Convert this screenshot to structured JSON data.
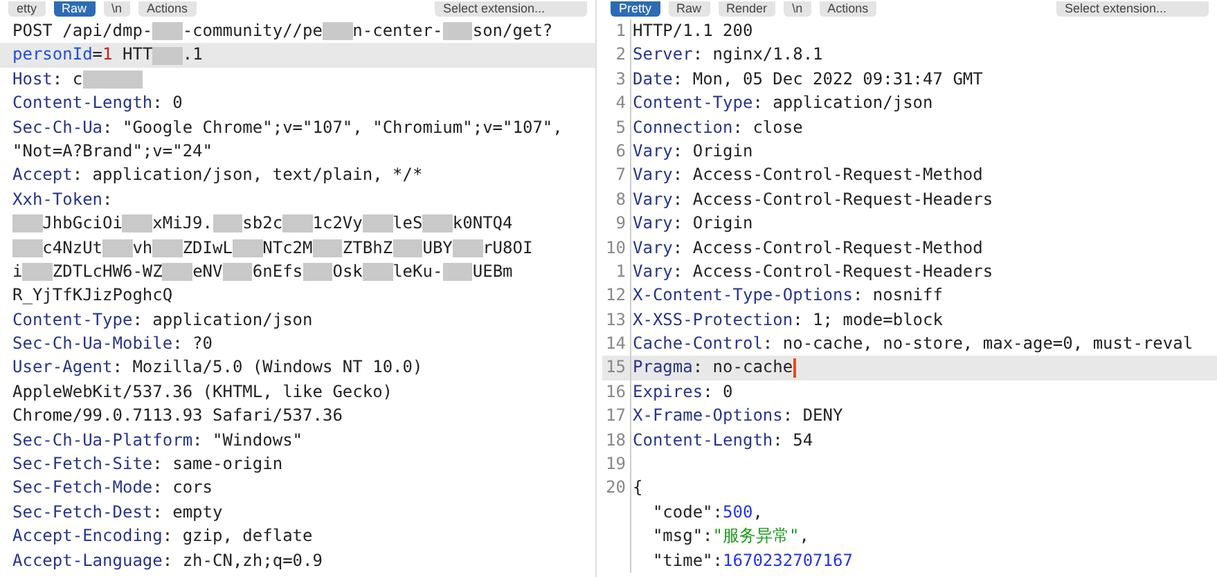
{
  "request": {
    "toolbar": {
      "tabs": [
        {
          "label": "etty",
          "selected": false
        },
        {
          "label": "Raw",
          "selected": true
        }
      ],
      "newline_button": "\\n",
      "actions_button": "Actions",
      "extension_select": "Select extension..."
    },
    "rows": [
      {
        "highlighted": false,
        "segments": [
          {
            "kind": "plain",
            "text": "POST /api/dmp-"
          },
          {
            "kind": "redacted"
          },
          {
            "kind": "plain",
            "text": "-community//pe"
          },
          {
            "kind": "redacted"
          },
          {
            "kind": "plain",
            "text": "n-center-"
          },
          {
            "kind": "redacted"
          },
          {
            "kind": "plain",
            "text": "son/get?"
          }
        ]
      },
      {
        "highlighted": true,
        "segments": [
          {
            "kind": "param",
            "text": "personId"
          },
          {
            "kind": "plain",
            "text": "="
          },
          {
            "kind": "red",
            "text": "1"
          },
          {
            "kind": "plain",
            "text": " HTT"
          },
          {
            "kind": "redacted"
          },
          {
            "kind": "plain",
            "text": ".1"
          }
        ]
      },
      {
        "highlighted": false,
        "segments": [
          {
            "kind": "key",
            "text": "Host"
          },
          {
            "kind": "plain",
            "text": ": c"
          },
          {
            "kind": "redacted"
          },
          {
            "kind": "redacted"
          }
        ]
      },
      {
        "highlighted": false,
        "segments": [
          {
            "kind": "key",
            "text": "Content-Length"
          },
          {
            "kind": "plain",
            "text": ": 0"
          }
        ]
      },
      {
        "highlighted": false,
        "segments": [
          {
            "kind": "key",
            "text": "Sec-Ch-Ua"
          },
          {
            "kind": "plain",
            "text": ": \"Google Chrome\";v=\"107\", \"Chromium\";v=\"107\","
          }
        ]
      },
      {
        "highlighted": false,
        "segments": [
          {
            "kind": "plain",
            "text": "\"Not=A?Brand\";v=\"24\""
          }
        ]
      },
      {
        "highlighted": false,
        "segments": [
          {
            "kind": "key",
            "text": "Accept"
          },
          {
            "kind": "plain",
            "text": ": application/json, text/plain, */*"
          }
        ]
      },
      {
        "highlighted": false,
        "segments": [
          {
            "kind": "key",
            "text": "Xxh-Token"
          },
          {
            "kind": "plain",
            "text": ":"
          }
        ]
      },
      {
        "highlighted": false,
        "segments": [
          {
            "kind": "redacted"
          },
          {
            "kind": "plain",
            "text": "JhbGciOi"
          },
          {
            "kind": "redacted"
          },
          {
            "kind": "plain",
            "text": "xMiJ9."
          },
          {
            "kind": "redacted"
          },
          {
            "kind": "plain",
            "text": "sb2c"
          },
          {
            "kind": "redacted"
          },
          {
            "kind": "plain",
            "text": "1c2Vy"
          },
          {
            "kind": "redacted"
          },
          {
            "kind": "plain",
            "text": "leS"
          },
          {
            "kind": "redacted"
          },
          {
            "kind": "plain",
            "text": "k0NTQ4"
          }
        ]
      },
      {
        "highlighted": false,
        "segments": [
          {
            "kind": "redacted"
          },
          {
            "kind": "plain",
            "text": "c4NzUt"
          },
          {
            "kind": "redacted"
          },
          {
            "kind": "plain",
            "text": "vh"
          },
          {
            "kind": "redacted"
          },
          {
            "kind": "plain",
            "text": "ZDIwL"
          },
          {
            "kind": "redacted"
          },
          {
            "kind": "plain",
            "text": "NTc2M"
          },
          {
            "kind": "redacted"
          },
          {
            "kind": "plain",
            "text": "ZTBhZ"
          },
          {
            "kind": "redacted"
          },
          {
            "kind": "plain",
            "text": "UBY"
          },
          {
            "kind": "redacted"
          },
          {
            "kind": "plain",
            "text": "rU8OI"
          }
        ]
      },
      {
        "highlighted": false,
        "segments": [
          {
            "kind": "plain",
            "text": "i"
          },
          {
            "kind": "redacted"
          },
          {
            "kind": "plain",
            "text": "ZDTLcHW6-WZ"
          },
          {
            "kind": "redacted"
          },
          {
            "kind": "plain",
            "text": "eNV"
          },
          {
            "kind": "redacted"
          },
          {
            "kind": "plain",
            "text": "6nEfs"
          },
          {
            "kind": "redacted"
          },
          {
            "kind": "plain",
            "text": "Osk"
          },
          {
            "kind": "redacted"
          },
          {
            "kind": "plain",
            "text": "leKu-"
          },
          {
            "kind": "redacted"
          },
          {
            "kind": "plain",
            "text": "UEBm"
          }
        ]
      },
      {
        "highlighted": false,
        "segments": [
          {
            "kind": "plain",
            "text": "R_YjTfKJizPoghcQ"
          }
        ]
      },
      {
        "highlighted": false,
        "segments": [
          {
            "kind": "key",
            "text": "Content-Type"
          },
          {
            "kind": "plain",
            "text": ": application/json"
          }
        ]
      },
      {
        "highlighted": false,
        "segments": [
          {
            "kind": "key",
            "text": "Sec-Ch-Ua-Mobile"
          },
          {
            "kind": "plain",
            "text": ": ?0"
          }
        ]
      },
      {
        "highlighted": false,
        "segments": [
          {
            "kind": "key",
            "text": "User-Agent"
          },
          {
            "kind": "plain",
            "text": ": Mozilla/5.0 (Windows NT 10.0)"
          }
        ]
      },
      {
        "highlighted": false,
        "segments": [
          {
            "kind": "plain",
            "text": "AppleWebKit/537.36 (KHTML, like Gecko)"
          }
        ]
      },
      {
        "highlighted": false,
        "segments": [
          {
            "kind": "plain",
            "text": "Chrome/99.0.7113.93 Safari/537.36"
          }
        ]
      },
      {
        "highlighted": false,
        "segments": [
          {
            "kind": "key",
            "text": "Sec-Ch-Ua-Platform"
          },
          {
            "kind": "plain",
            "text": ": \"Windows\""
          }
        ]
      },
      {
        "highlighted": false,
        "segments": [
          {
            "kind": "key",
            "text": "Sec-Fetch-Site"
          },
          {
            "kind": "plain",
            "text": ": same-origin"
          }
        ]
      },
      {
        "highlighted": false,
        "segments": [
          {
            "kind": "key",
            "text": "Sec-Fetch-Mode"
          },
          {
            "kind": "plain",
            "text": ": cors"
          }
        ]
      },
      {
        "highlighted": false,
        "segments": [
          {
            "kind": "key",
            "text": "Sec-Fetch-Dest"
          },
          {
            "kind": "plain",
            "text": ": empty"
          }
        ]
      },
      {
        "highlighted": false,
        "segments": [
          {
            "kind": "key",
            "text": "Accept-Encoding"
          },
          {
            "kind": "plain",
            "text": ": gzip, deflate"
          }
        ]
      },
      {
        "highlighted": false,
        "segments": [
          {
            "kind": "key",
            "text": "Accept-Language"
          },
          {
            "kind": "plain",
            "text": ": zh-CN,zh;q=0.9"
          }
        ]
      }
    ]
  },
  "response": {
    "toolbar": {
      "tabs": [
        {
          "label": "Pretty",
          "selected": true
        },
        {
          "label": "Raw",
          "selected": false
        },
        {
          "label": "Render",
          "selected": false
        }
      ],
      "newline_button": "\\n",
      "actions_button": "Actions",
      "extension_select": "Select extension..."
    },
    "rows": [
      {
        "number": "1",
        "highlighted": false,
        "cursor": false,
        "segments": [
          {
            "kind": "plain",
            "text": "HTTP/1.1 200"
          }
        ]
      },
      {
        "number": "2",
        "highlighted": false,
        "cursor": false,
        "segments": [
          {
            "kind": "key",
            "text": "Server"
          },
          {
            "kind": "plain",
            "text": ": nginx/1.8.1"
          }
        ]
      },
      {
        "number": "3",
        "highlighted": false,
        "cursor": false,
        "segments": [
          {
            "kind": "key",
            "text": "Date"
          },
          {
            "kind": "plain",
            "text": ": Mon, 05 Dec 2022 09:31:47 GMT"
          }
        ]
      },
      {
        "number": "4",
        "highlighted": false,
        "cursor": false,
        "segments": [
          {
            "kind": "key",
            "text": "Content-Type"
          },
          {
            "kind": "plain",
            "text": ": application/json"
          }
        ]
      },
      {
        "number": "5",
        "highlighted": false,
        "cursor": false,
        "segments": [
          {
            "kind": "key",
            "text": "Connection"
          },
          {
            "kind": "plain",
            "text": ": close"
          }
        ]
      },
      {
        "number": "6",
        "highlighted": false,
        "cursor": false,
        "segments": [
          {
            "kind": "key",
            "text": "Vary"
          },
          {
            "kind": "plain",
            "text": ": Origin"
          }
        ]
      },
      {
        "number": "7",
        "highlighted": false,
        "cursor": false,
        "segments": [
          {
            "kind": "key",
            "text": "Vary"
          },
          {
            "kind": "plain",
            "text": ": Access-Control-Request-Method"
          }
        ]
      },
      {
        "number": "8",
        "highlighted": false,
        "cursor": false,
        "segments": [
          {
            "kind": "key",
            "text": "Vary"
          },
          {
            "kind": "plain",
            "text": ": Access-Control-Request-Headers"
          }
        ]
      },
      {
        "number": "9",
        "highlighted": false,
        "cursor": false,
        "segments": [
          {
            "kind": "key",
            "text": "Vary"
          },
          {
            "kind": "plain",
            "text": ": Origin"
          }
        ]
      },
      {
        "number": "10",
        "highlighted": false,
        "cursor": false,
        "segments": [
          {
            "kind": "key",
            "text": "Vary"
          },
          {
            "kind": "plain",
            "text": ": Access-Control-Request-Method"
          }
        ]
      },
      {
        "number": "1",
        "highlighted": false,
        "cursor": false,
        "segments": [
          {
            "kind": "key",
            "text": "Vary"
          },
          {
            "kind": "plain",
            "text": ": Access-Control-Request-Headers"
          }
        ]
      },
      {
        "number": "12",
        "highlighted": false,
        "cursor": false,
        "segments": [
          {
            "kind": "key",
            "text": "X-Content-Type-Options"
          },
          {
            "kind": "plain",
            "text": ": nosniff"
          }
        ]
      },
      {
        "number": "13",
        "highlighted": false,
        "cursor": false,
        "segments": [
          {
            "kind": "key",
            "text": "X-XSS-Protection"
          },
          {
            "kind": "plain",
            "text": ": 1; mode=block"
          }
        ]
      },
      {
        "number": "14",
        "highlighted": false,
        "cursor": false,
        "segments": [
          {
            "kind": "key",
            "text": "Cache-Control"
          },
          {
            "kind": "plain",
            "text": ": no-cache, no-store, max-age=0, must-reval"
          }
        ]
      },
      {
        "number": "15",
        "highlighted": true,
        "cursor": true,
        "segments": [
          {
            "kind": "key",
            "text": "Pragma"
          },
          {
            "kind": "plain",
            "text": ": no-cache"
          }
        ]
      },
      {
        "number": "16",
        "highlighted": false,
        "cursor": false,
        "segments": [
          {
            "kind": "key",
            "text": "Expires"
          },
          {
            "kind": "plain",
            "text": ": 0"
          }
        ]
      },
      {
        "number": "17",
        "highlighted": false,
        "cursor": false,
        "segments": [
          {
            "kind": "key",
            "text": "X-Frame-Options"
          },
          {
            "kind": "plain",
            "text": ": DENY"
          }
        ]
      },
      {
        "number": "18",
        "highlighted": false,
        "cursor": false,
        "segments": [
          {
            "kind": "key",
            "text": "Content-Length"
          },
          {
            "kind": "plain",
            "text": ": 54"
          }
        ]
      },
      {
        "number": "19",
        "highlighted": false,
        "cursor": false,
        "segments": []
      },
      {
        "number": "20",
        "highlighted": false,
        "cursor": false,
        "segments": [
          {
            "kind": "plain",
            "text": "{"
          }
        ]
      },
      {
        "highlighted": false,
        "cursor": false,
        "segments": [
          {
            "kind": "indent"
          },
          {
            "kind": "plain",
            "text": "\"code\":"
          },
          {
            "kind": "num",
            "text": "500"
          },
          {
            "kind": "plain",
            "text": ","
          }
        ]
      },
      {
        "highlighted": false,
        "cursor": false,
        "segments": [
          {
            "kind": "indent"
          },
          {
            "kind": "plain",
            "text": "\"msg\":"
          },
          {
            "kind": "str",
            "text": "\"服务异常\""
          },
          {
            "kind": "plain",
            "text": ","
          }
        ]
      },
      {
        "highlighted": false,
        "cursor": false,
        "segments": [
          {
            "kind": "indent"
          },
          {
            "kind": "plain",
            "text": "\"time\":"
          },
          {
            "kind": "num",
            "text": "1670232707167"
          }
        ]
      }
    ]
  }
}
